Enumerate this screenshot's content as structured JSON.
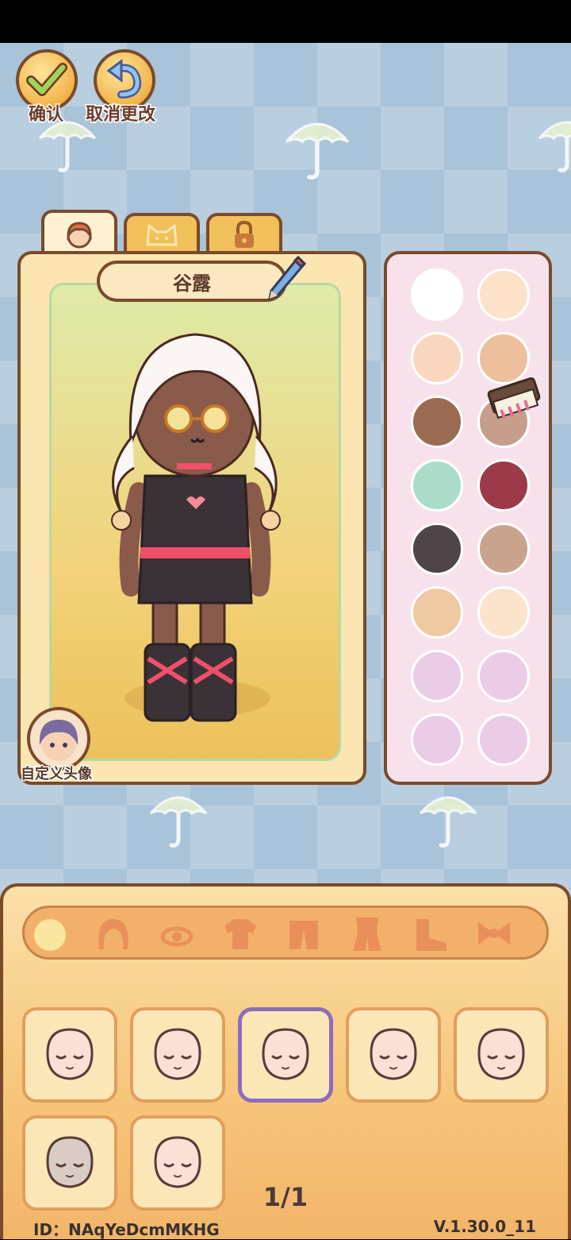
{
  "top_buttons": {
    "confirm_label": "确认",
    "cancel_label": "取消更改"
  },
  "tabs": [
    {
      "name": "character-tab",
      "icon": "person-icon",
      "active": true
    },
    {
      "name": "pet-tab",
      "icon": "cat-icon",
      "active": false
    },
    {
      "name": "locked-tab",
      "icon": "lock-icon",
      "active": false
    }
  ],
  "character": {
    "name": "谷露",
    "custom_avatar_label": "自定义头像"
  },
  "palette": {
    "swatches": [
      "#ffffff",
      "#fbe2c8",
      "#fbd6bf",
      "#eebf9c",
      "#9b6a52",
      "#c79e8c",
      "#a9ddc9",
      "#9c3a4a",
      "#4f4448",
      "#c9a48c",
      "#efc8a4",
      "#fce3cc",
      "#ebcce6",
      "#ebcce6",
      "#ebcce6",
      "#ebcce6"
    ]
  },
  "categories": [
    {
      "name": "cat-face",
      "icon": "face-icon"
    },
    {
      "name": "cat-hair",
      "icon": "hair-icon"
    },
    {
      "name": "cat-eyes",
      "icon": "eye-icon"
    },
    {
      "name": "cat-top",
      "icon": "shirt-icon"
    },
    {
      "name": "cat-coat",
      "icon": "coat-icon"
    },
    {
      "name": "cat-outfit",
      "icon": "outfit-icon"
    },
    {
      "name": "cat-shoes",
      "icon": "shoe-icon"
    },
    {
      "name": "cat-accessory",
      "icon": "bow-icon"
    }
  ],
  "faces": {
    "count": 7,
    "selected_index": 2
  },
  "pagination": "1/1",
  "footer": {
    "id_text": "ID：NAqYeDcmMKHG",
    "version": "V.1.30.0_11"
  },
  "colors": {
    "outline": "#7a4a2a",
    "selected_border": "#8c6dbd",
    "background": "#a9c3d8"
  }
}
